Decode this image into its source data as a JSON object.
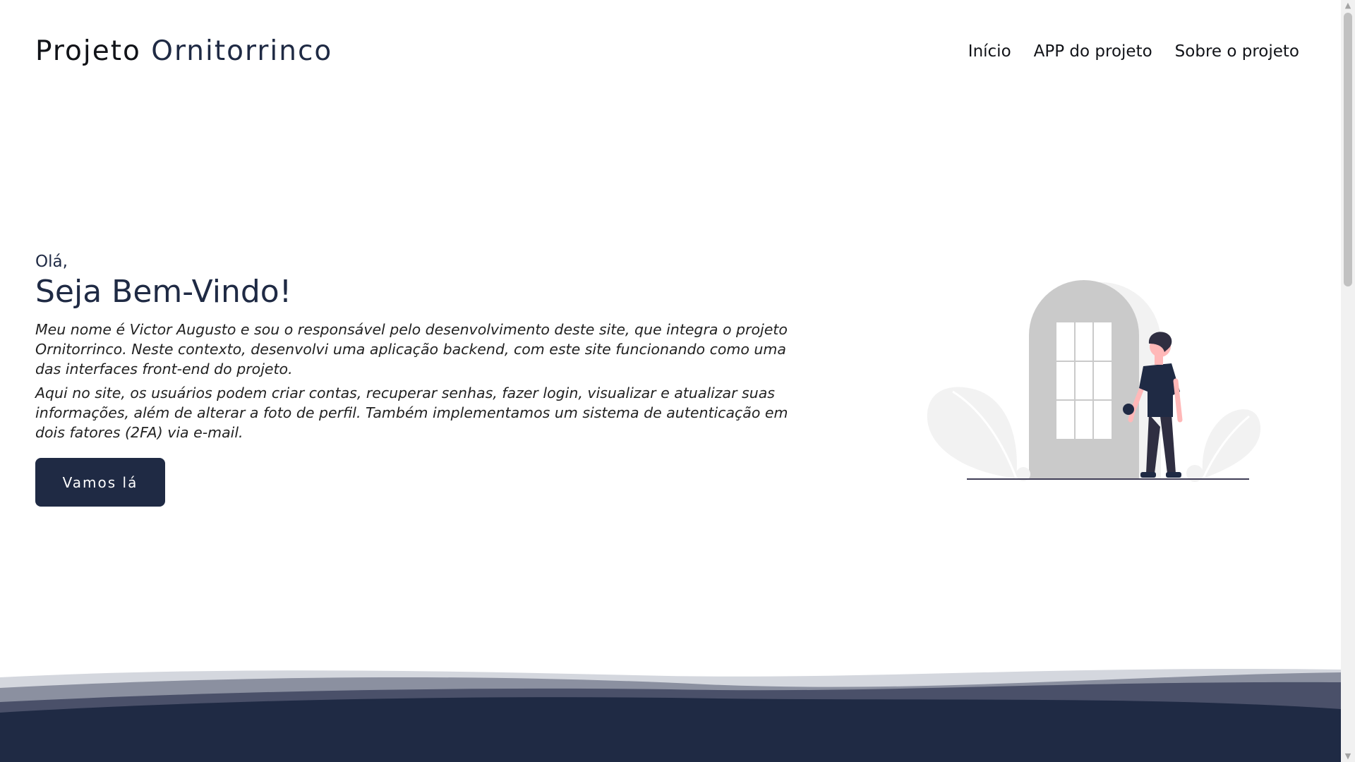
{
  "header": {
    "brand_part1": "Projeto",
    "brand_part2": "Ornitorrinco",
    "nav": [
      {
        "label": "Início"
      },
      {
        "label": "APP do projeto"
      },
      {
        "label": "Sobre o projeto"
      }
    ]
  },
  "hero": {
    "greeting": "Olá,",
    "headline": "Seja Bem-Vindo!",
    "paragraph1": "Meu nome é Victor Augusto e sou o responsável pelo desenvolvimento deste site, que integra o projeto Ornitorrinco. Neste contexto, desenvolvi uma aplicação backend, com este site funcionando como uma das interfaces front-end do projeto.",
    "paragraph2": "Aqui no site, os usuários podem criar contas, recuperar senhas, fazer login, visualizar e atualizar suas informações, além de alterar a foto de perfil. Também implementamos um sistema de autenticação em dois fatores (2FA) via e-mail.",
    "cta_label": "Vamos lá"
  },
  "colors": {
    "primary": "#1f2a44",
    "illustration_grey": "#cacaca",
    "illustration_light": "#f2f2f2",
    "skin": "#ffb8b8"
  },
  "icons": {
    "illustration": "person-at-door-illustration",
    "scroll_up": "scroll-up-arrow-icon",
    "scroll_down": "scroll-down-arrow-icon"
  }
}
